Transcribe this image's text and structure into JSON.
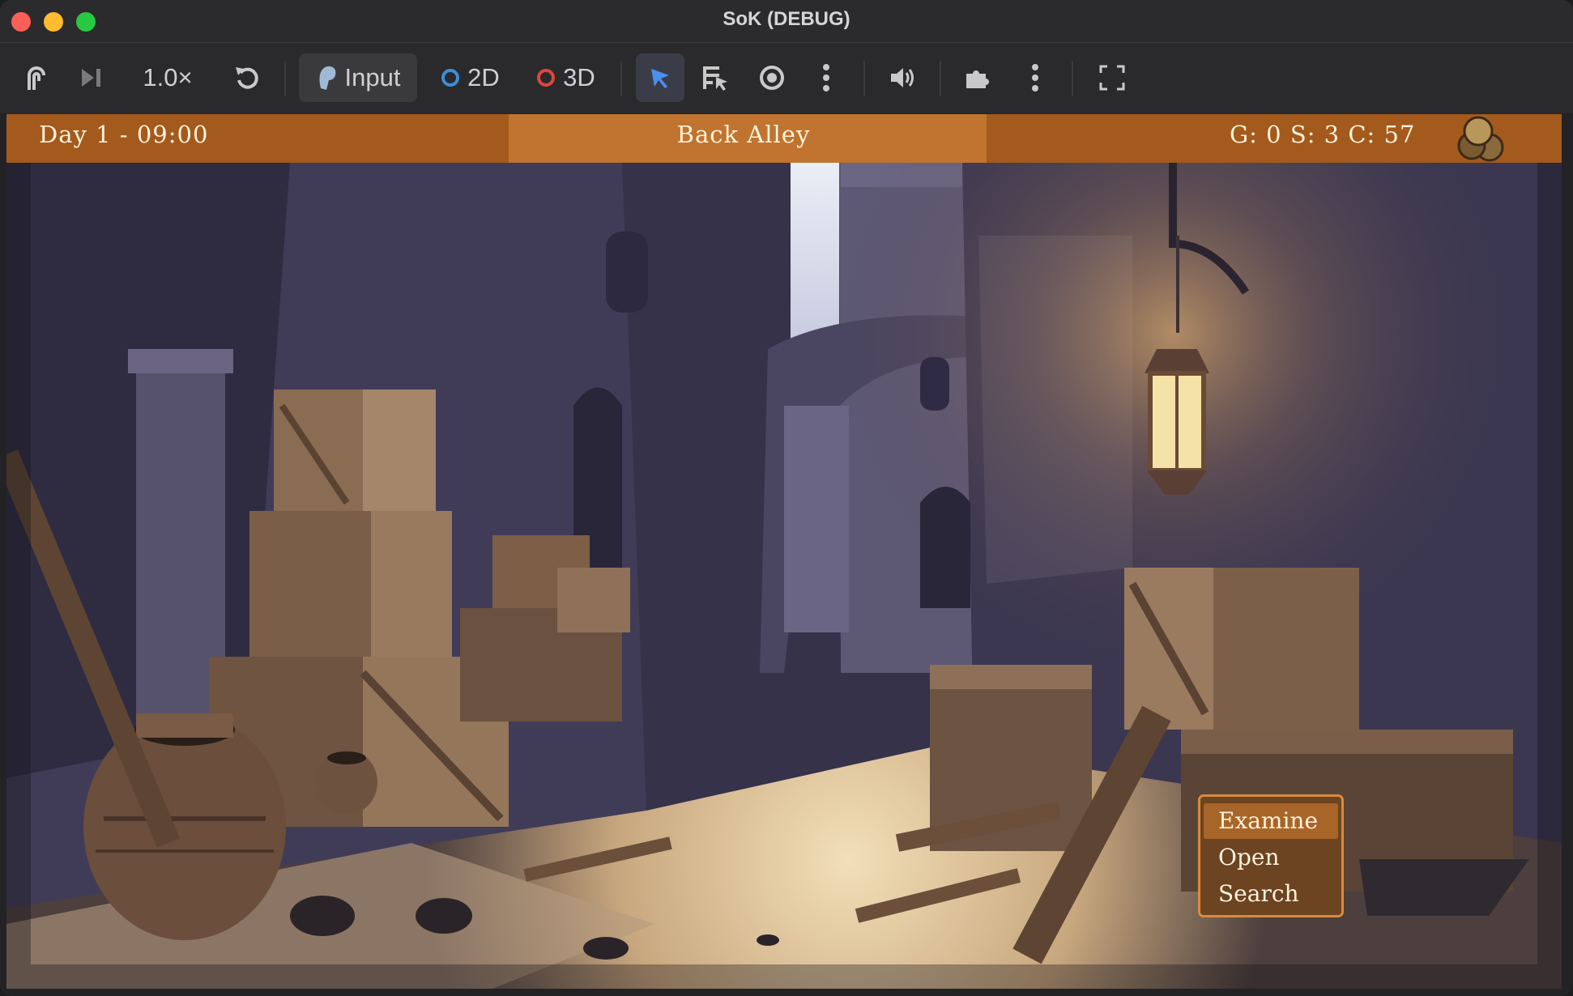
{
  "window": {
    "title": "SoK (DEBUG)"
  },
  "toolbar": {
    "speed_label": "1.0×",
    "input_label": "Input",
    "mode_2d_label": "2D",
    "mode_3d_label": "3D",
    "icons": [
      "remote-debug-icon",
      "step-frame-icon",
      "reload-icon",
      "input-hand-icon",
      "select-arrow-icon",
      "list-select-icon",
      "camera-view-icon",
      "more-vertical-icon",
      "speaker-icon",
      "puzzle-icon",
      "more-vertical-icon",
      "fullscreen-icon"
    ],
    "colors": {
      "active_blue": "#4b8ff0",
      "ring_2d": "#3c8fd9",
      "ring_3d": "#e0463d"
    }
  },
  "hud": {
    "time": "Day 1 - 09:00",
    "location": "Back Alley",
    "currency": "G: 0 S: 3 C: 57",
    "colors": {
      "bar": "#a45a1c",
      "text": "#fff2dc"
    }
  },
  "context_menu": {
    "items": [
      {
        "label": "Examine",
        "selected": true
      },
      {
        "label": "Open",
        "selected": false
      },
      {
        "label": "Search",
        "selected": false
      }
    ]
  }
}
